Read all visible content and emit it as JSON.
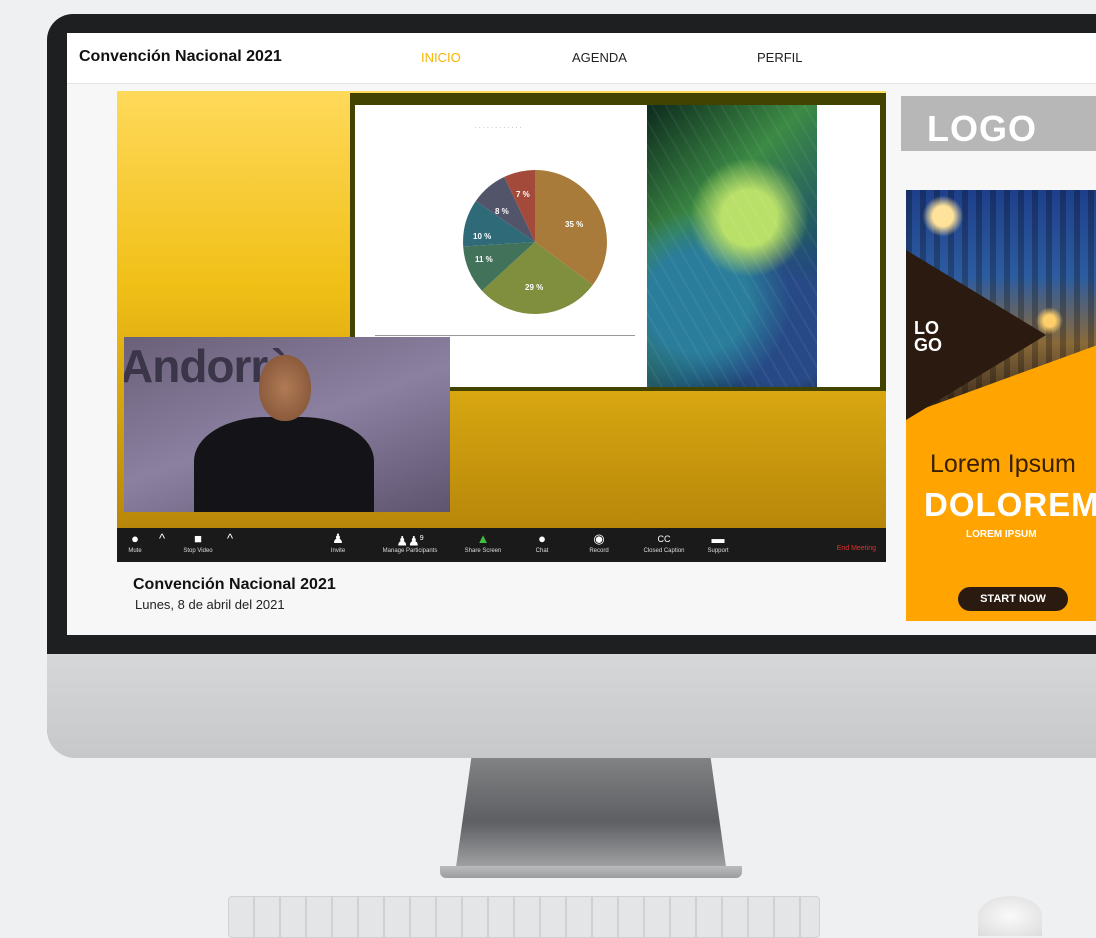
{
  "header": {
    "site_title": "Convención Nacional 2021",
    "nav": {
      "inicio": "INICIO",
      "agenda": "AGENDA",
      "perfil": "PERFIL"
    }
  },
  "slide": {
    "pie_labels": [
      "35 %",
      "29 %",
      "11 %",
      "10 %",
      "8 %",
      "7 %"
    ]
  },
  "toolbar": {
    "mute": "Mute",
    "stop_video": "Stop Video",
    "invite": "Invite",
    "manage_participants": "Manage Participants",
    "participant_count": "9",
    "share_screen": "Share Screen",
    "chat": "Chat",
    "record": "Record",
    "closed_caption": "Closed Caption",
    "support": "Support",
    "end_meeting": "End Meeting"
  },
  "event": {
    "title": "Convención Nacional 2021",
    "date": "Lunes, 8 de abril del 2021"
  },
  "sidebar": {
    "logo": "LOGO",
    "ad": {
      "logo_line1": "LO",
      "logo_line2": "GO",
      "lorem": "Lorem Ipsum",
      "dolorem": "DOLOREM",
      "small": "LOREM IPSUM",
      "button": "START NOW"
    }
  },
  "colors": {
    "accent": "#f5b500",
    "ad_orange": "#ffa400",
    "end_meeting": "#e0302a"
  }
}
